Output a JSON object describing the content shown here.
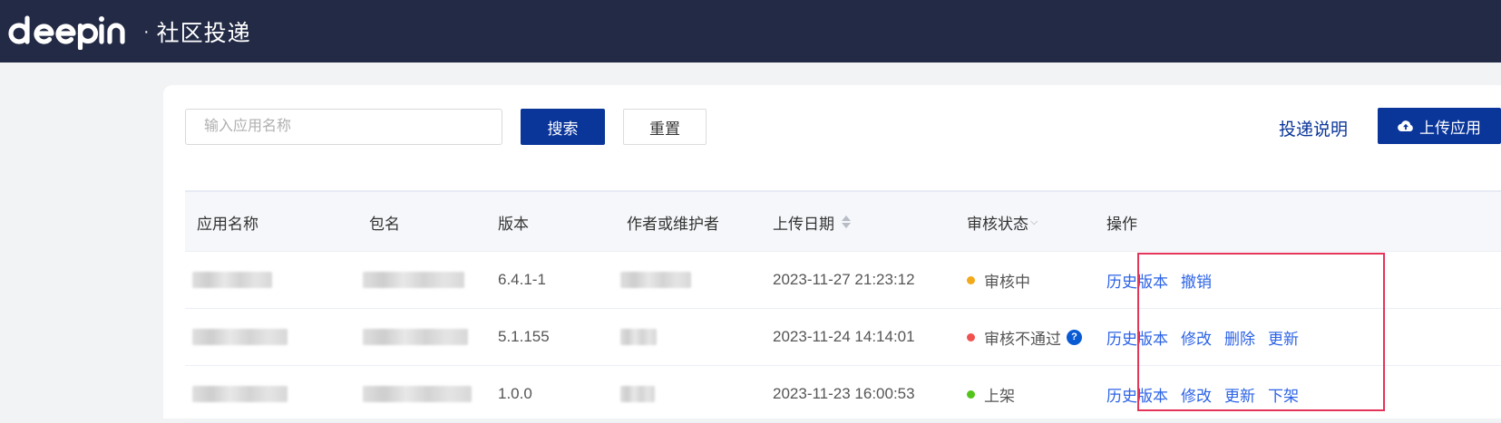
{
  "header": {
    "logo_text": "deepin",
    "separator": "·",
    "subtitle": "社区投递"
  },
  "toolbar": {
    "search_placeholder": "输入应用名称",
    "search_label": "搜索",
    "reset_label": "重置",
    "help_label": "投递说明",
    "upload_label": "上传应用"
  },
  "table": {
    "columns": [
      "应用名称",
      "包名",
      "版本",
      "作者或维护者",
      "上传日期",
      "审核状态",
      "操作"
    ],
    "rows": [
      {
        "version": "6.4.1-1",
        "date": "2023-11-27 21:23:12",
        "status": "审核中",
        "status_color": "#f2a91b",
        "actions": [
          "历史版本",
          "撤销"
        ]
      },
      {
        "version": "5.1.155",
        "date": "2023-11-24 14:14:01",
        "status": "审核不通过",
        "status_color": "#ef5350",
        "help_icon": "?",
        "actions": [
          "历史版本",
          "修改",
          "删除",
          "更新"
        ]
      },
      {
        "version": "1.0.0",
        "date": "2023-11-23 16:00:53",
        "status": "上架",
        "status_color": "#52c41a",
        "actions": [
          "历史版本",
          "修改",
          "更新",
          "下架"
        ]
      }
    ]
  },
  "colors": {
    "header_bg": "#232a45",
    "primary": "#0a3599",
    "link": "#2c63e6",
    "highlight": "#e4345a"
  }
}
